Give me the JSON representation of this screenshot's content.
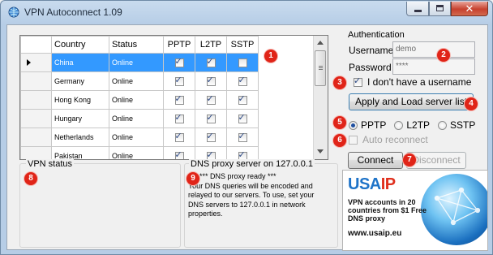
{
  "window": {
    "title": "VPN Autoconnect 1.09"
  },
  "grid": {
    "columns": [
      "Country",
      "Status",
      "PPTP",
      "L2TP",
      "SSTP"
    ],
    "rows": [
      {
        "country": "China",
        "status": "Online",
        "pptp": true,
        "l2tp": true,
        "sstp": false,
        "selected": true
      },
      {
        "country": "Germany",
        "status": "Online",
        "pptp": true,
        "l2tp": true,
        "sstp": true
      },
      {
        "country": "Hong Kong",
        "status": "Online",
        "pptp": true,
        "l2tp": true,
        "sstp": true
      },
      {
        "country": "Hungary",
        "status": "Online",
        "pptp": true,
        "l2tp": true,
        "sstp": true
      },
      {
        "country": "Netherlands",
        "status": "Online",
        "pptp": true,
        "l2tp": true,
        "sstp": true
      },
      {
        "country": "Pakistan",
        "status": "Online",
        "pptp": true,
        "l2tp": true,
        "sstp": true
      }
    ]
  },
  "auth": {
    "title": "Authentication",
    "username_label": "Username",
    "username_value": "demo",
    "password_label": "Password",
    "password_value": "****",
    "no_username_label": "I don't have a username",
    "no_username_checked": true,
    "apply_button": "Apply and Load server list"
  },
  "protocols": {
    "options": [
      "PPTP",
      "L2TP",
      "SSTP"
    ],
    "selected": "PPTP"
  },
  "auto_reconnect": {
    "label": "Auto reconnect",
    "checked": false
  },
  "actions": {
    "connect": "Connect",
    "disconnect": "Disconnect"
  },
  "vpn_status": {
    "title": "VPN status"
  },
  "dns": {
    "title": "DNS proxy server on 127.0.0.1",
    "lines": [
      "*** DNS proxy ready ***",
      "Your DNS queries will be encoded and",
      "relayed to our servers. To use, set your",
      "DNS servers to 127.0.0.1 in network",
      "properties."
    ]
  },
  "ad": {
    "logo_a": "USA",
    "logo_b": "IP",
    "text": "VPN accounts in 20 countries from $1 Free DNS proxy",
    "url": "www.usaip.eu"
  },
  "badges": [
    "1",
    "2",
    "3",
    "4",
    "5",
    "6",
    "7",
    "8",
    "9"
  ],
  "colors": {
    "selection": "#3399ff",
    "badge": "#e02418",
    "title_bar": "#c9dbee"
  }
}
